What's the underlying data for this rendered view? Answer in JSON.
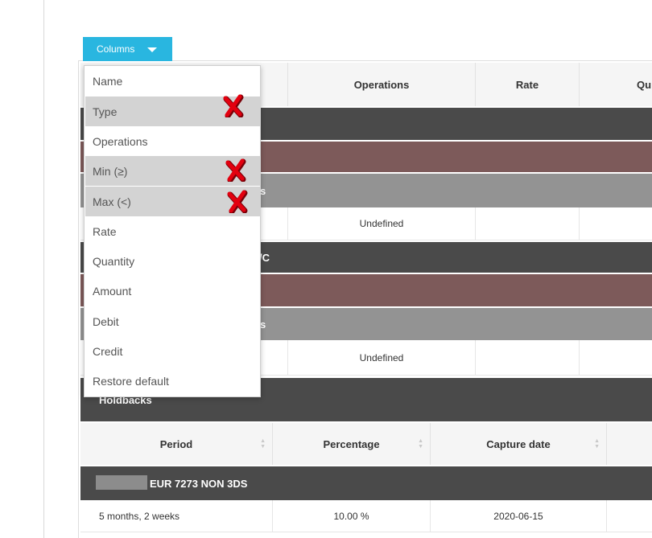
{
  "columns_button": {
    "label": "Columns",
    "icon": "caret-down-icon"
  },
  "dropdown_items": [
    {
      "label": "Name",
      "selected": false
    },
    {
      "label": "Type",
      "selected": true
    },
    {
      "label": "Operations",
      "selected": false
    },
    {
      "label": "Min (≥)",
      "selected": true
    },
    {
      "label": "Max (<)",
      "selected": true
    },
    {
      "label": "Rate",
      "selected": false
    },
    {
      "label": "Quantity",
      "selected": false
    },
    {
      "label": "Amount",
      "selected": false
    },
    {
      "label": "Debit",
      "selected": false
    },
    {
      "label": "Credit",
      "selected": false
    },
    {
      "label": "Restore default",
      "selected": false
    }
  ],
  "annotation_marks": {
    "icon": "red-x-mark-icon",
    "color": "#e3000f"
  },
  "fees_table": {
    "headers": {
      "operations": "Operations",
      "rate": "Rate",
      "quantity_partial": "Qu"
    },
    "group_1": {
      "gray_bar_partial": "s",
      "operations_value": "Undefined"
    },
    "group_2": {
      "dark_bar_partial": "/C",
      "gray_bar_partial": "s",
      "operations_value": "Undefined"
    }
  },
  "holdbacks": {
    "title": "Holdbacks",
    "headers": {
      "period": "Period",
      "percentage": "Percentage",
      "capture_date": "Capture date"
    },
    "group_label": "EUR 7273 NON 3DS",
    "row": {
      "period": "5 months, 2 weeks",
      "percentage": "10.00 %",
      "capture_date": "2020-06-15"
    }
  },
  "colors": {
    "button_bg": "#29b6e0",
    "dark_bar": "#4a4a4a",
    "brown_bar": "#7d5a5a",
    "gray_bar": "#939393",
    "selected_item_bg": "#d3d3d3"
  }
}
